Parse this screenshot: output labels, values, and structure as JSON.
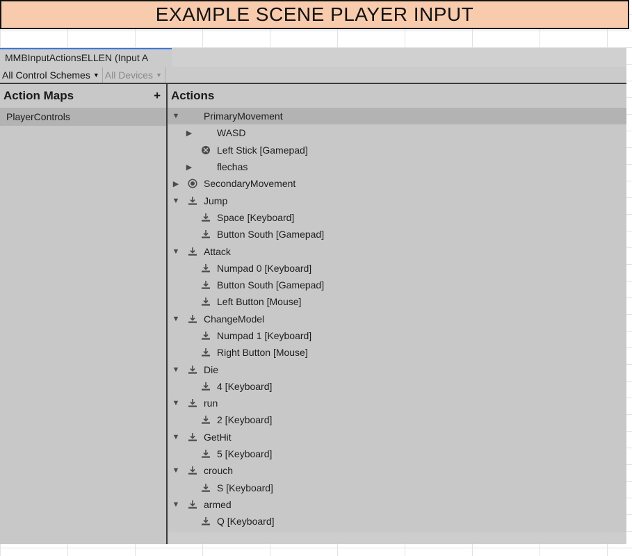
{
  "banner": {
    "title": "EXAMPLE SCENE PLAYER INPUT"
  },
  "window": {
    "tab_label": "MMBInputActionsELLEN (Input A",
    "control_schemes": "All Control Schemes",
    "devices": "All Devices"
  },
  "action_maps": {
    "header": "Action Maps",
    "add_symbol": "+",
    "items": [
      {
        "label": "PlayerControls"
      }
    ]
  },
  "actions": {
    "header": "Actions",
    "rows": [
      {
        "label": "PrimaryMovement",
        "level": 0,
        "fold": "open",
        "icon": "none",
        "selected": true
      },
      {
        "label": "WASD",
        "level": 1,
        "fold": "closed",
        "icon": "none"
      },
      {
        "label": "Left Stick [Gamepad]",
        "level": 1,
        "fold": "none",
        "icon": "stick-icon"
      },
      {
        "label": "flechas",
        "level": 1,
        "fold": "closed",
        "icon": "none"
      },
      {
        "label": "SecondaryMovement",
        "level": 0,
        "fold": "closed",
        "icon": "radio-icon"
      },
      {
        "label": "Jump",
        "level": 0,
        "fold": "open",
        "icon": "button-icon"
      },
      {
        "label": "Space [Keyboard]",
        "level": 1,
        "fold": "none",
        "icon": "button-icon"
      },
      {
        "label": "Button South [Gamepad]",
        "level": 1,
        "fold": "none",
        "icon": "button-icon"
      },
      {
        "label": "Attack",
        "level": 0,
        "fold": "open",
        "icon": "button-icon"
      },
      {
        "label": "Numpad 0 [Keyboard]",
        "level": 1,
        "fold": "none",
        "icon": "button-icon"
      },
      {
        "label": "Button South [Gamepad]",
        "level": 1,
        "fold": "none",
        "icon": "button-icon"
      },
      {
        "label": "Left Button [Mouse]",
        "level": 1,
        "fold": "none",
        "icon": "button-icon"
      },
      {
        "label": "ChangeModel",
        "level": 0,
        "fold": "open",
        "icon": "button-icon"
      },
      {
        "label": "Numpad 1 [Keyboard]",
        "level": 1,
        "fold": "none",
        "icon": "button-icon"
      },
      {
        "label": "Right Button [Mouse]",
        "level": 1,
        "fold": "none",
        "icon": "button-icon"
      },
      {
        "label": "Die",
        "level": 0,
        "fold": "open",
        "icon": "button-icon"
      },
      {
        "label": "4 [Keyboard]",
        "level": 1,
        "fold": "none",
        "icon": "button-icon"
      },
      {
        "label": "run",
        "level": 0,
        "fold": "open",
        "icon": "button-icon"
      },
      {
        "label": "2 [Keyboard]",
        "level": 1,
        "fold": "none",
        "icon": "button-icon"
      },
      {
        "label": "GetHit",
        "level": 0,
        "fold": "open",
        "icon": "button-icon"
      },
      {
        "label": "5 [Keyboard]",
        "level": 1,
        "fold": "none",
        "icon": "button-icon"
      },
      {
        "label": "crouch",
        "level": 0,
        "fold": "open",
        "icon": "button-icon"
      },
      {
        "label": "S [Keyboard]",
        "level": 1,
        "fold": "none",
        "icon": "button-icon"
      },
      {
        "label": "armed",
        "level": 0,
        "fold": "open",
        "icon": "button-icon"
      },
      {
        "label": "Q [Keyboard]",
        "level": 1,
        "fold": "none",
        "icon": "button-icon"
      }
    ]
  }
}
